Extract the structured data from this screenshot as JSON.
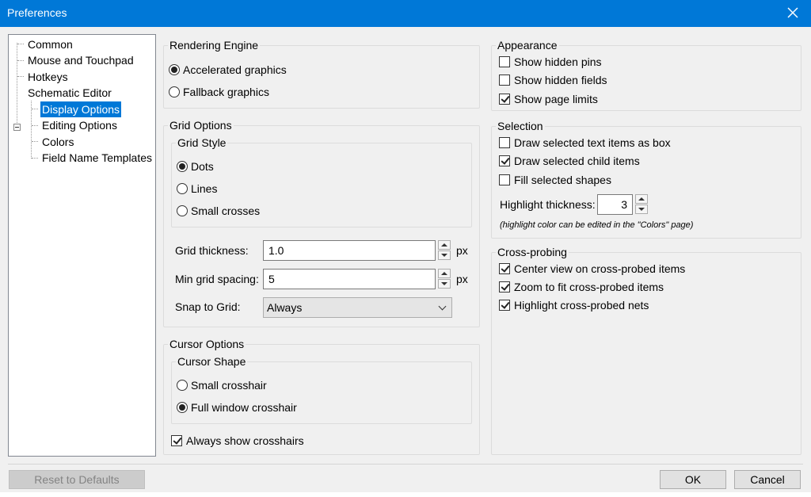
{
  "window": {
    "title": "Preferences"
  },
  "tree": {
    "items": [
      {
        "label": "Common"
      },
      {
        "label": "Mouse and Touchpad"
      },
      {
        "label": "Hotkeys"
      },
      {
        "label": "Schematic Editor"
      },
      {
        "label": "Display Options"
      },
      {
        "label": "Editing Options"
      },
      {
        "label": "Colors"
      },
      {
        "label": "Field Name Templates"
      }
    ],
    "selected": "Display Options"
  },
  "rendering": {
    "title": "Rendering Engine",
    "options": [
      {
        "label": "Accelerated graphics",
        "selected": true
      },
      {
        "label": "Fallback graphics",
        "selected": false
      }
    ]
  },
  "grid": {
    "title": "Grid Options",
    "style_title": "Grid Style",
    "styles": [
      {
        "label": "Dots",
        "selected": true
      },
      {
        "label": "Lines",
        "selected": false
      },
      {
        "label": "Small crosses",
        "selected": false
      }
    ],
    "thickness_label": "Grid thickness:",
    "thickness_value": "1.0",
    "thickness_unit": "px",
    "spacing_label": "Min grid spacing:",
    "spacing_value": "5",
    "spacing_unit": "px",
    "snap_label": "Snap to Grid:",
    "snap_value": "Always"
  },
  "cursor": {
    "title": "Cursor Options",
    "shape_title": "Cursor Shape",
    "shapes": [
      {
        "label": "Small crosshair",
        "selected": false
      },
      {
        "label": "Full window crosshair",
        "selected": true
      }
    ],
    "always_show_label": "Always show crosshairs",
    "always_show_checked": true
  },
  "appearance": {
    "title": "Appearance",
    "items": [
      {
        "label": "Show hidden pins",
        "checked": false
      },
      {
        "label": "Show hidden fields",
        "checked": false
      },
      {
        "label": "Show page limits",
        "checked": true
      }
    ]
  },
  "selection": {
    "title": "Selection",
    "items": [
      {
        "label": "Draw selected text items as box",
        "checked": false
      },
      {
        "label": "Draw selected child items",
        "checked": true
      },
      {
        "label": "Fill selected shapes",
        "checked": false
      }
    ],
    "highlight_label": "Highlight thickness:",
    "highlight_value": "3",
    "hint": "(highlight color can be edited in the \"Colors\" page)"
  },
  "crossprobing": {
    "title": "Cross-probing",
    "items": [
      {
        "label": "Center view on cross-probed items",
        "checked": true
      },
      {
        "label": "Zoom to fit cross-probed items",
        "checked": true
      },
      {
        "label": "Highlight cross-probed nets",
        "checked": true
      }
    ]
  },
  "buttons": {
    "reset": "Reset to Defaults",
    "ok": "OK",
    "cancel": "Cancel"
  },
  "colors": {
    "titlebar": "#0078d7",
    "selection": "#0078d7"
  }
}
